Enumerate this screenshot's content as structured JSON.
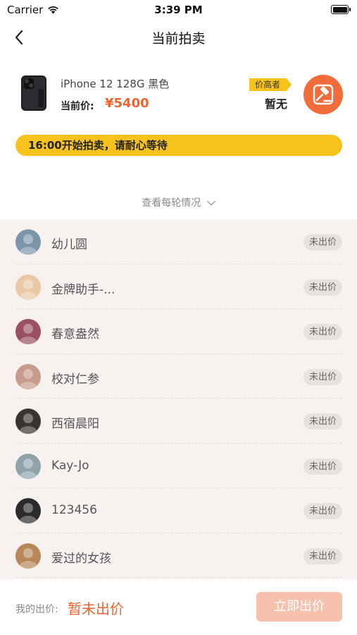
{
  "status_bar": {
    "carrier": "Carrier",
    "time": "3:39 PM"
  },
  "nav": {
    "title": "当前拍卖"
  },
  "product": {
    "name": "iPhone 12 128G 黑色",
    "price_label": "当前价:",
    "price": "¥5400",
    "top_bidder_tag": "价高者",
    "top_bidder_value": "暂无"
  },
  "notice": {
    "text": "16:00开始拍卖，请耐心等待"
  },
  "rounds_link": {
    "label": "查看每轮情况"
  },
  "participants": [
    {
      "name": "幼儿圆",
      "status": "未出价",
      "avatar_color": "#7a95a8"
    },
    {
      "name": "金牌助手-...",
      "status": "未出价",
      "avatar_color": "#e9c9a6"
    },
    {
      "name": "春意盎然",
      "status": "未出价",
      "avatar_color": "#9a5062"
    },
    {
      "name": "校对仁参",
      "status": "未出价",
      "avatar_color": "#c89a8a"
    },
    {
      "name": "西宿晨阳",
      "status": "未出价",
      "avatar_color": "#3a3430"
    },
    {
      "name": "Kay-Jo",
      "status": "未出价",
      "avatar_color": "#8fa3ad"
    },
    {
      "name": "123456",
      "status": "未出价",
      "avatar_color": "#2b2b2e"
    },
    {
      "name": "爱过的女孩",
      "status": "未出价",
      "avatar_color": "#b5875a"
    }
  ],
  "bottom": {
    "my_bid_label": "我的出价:",
    "my_bid_value": "暂未出价",
    "bid_button": "立即出价"
  },
  "colors": {
    "accent": "#f0632e",
    "highlight": "#f7c21c",
    "list_bg": "#f7f1ef"
  }
}
